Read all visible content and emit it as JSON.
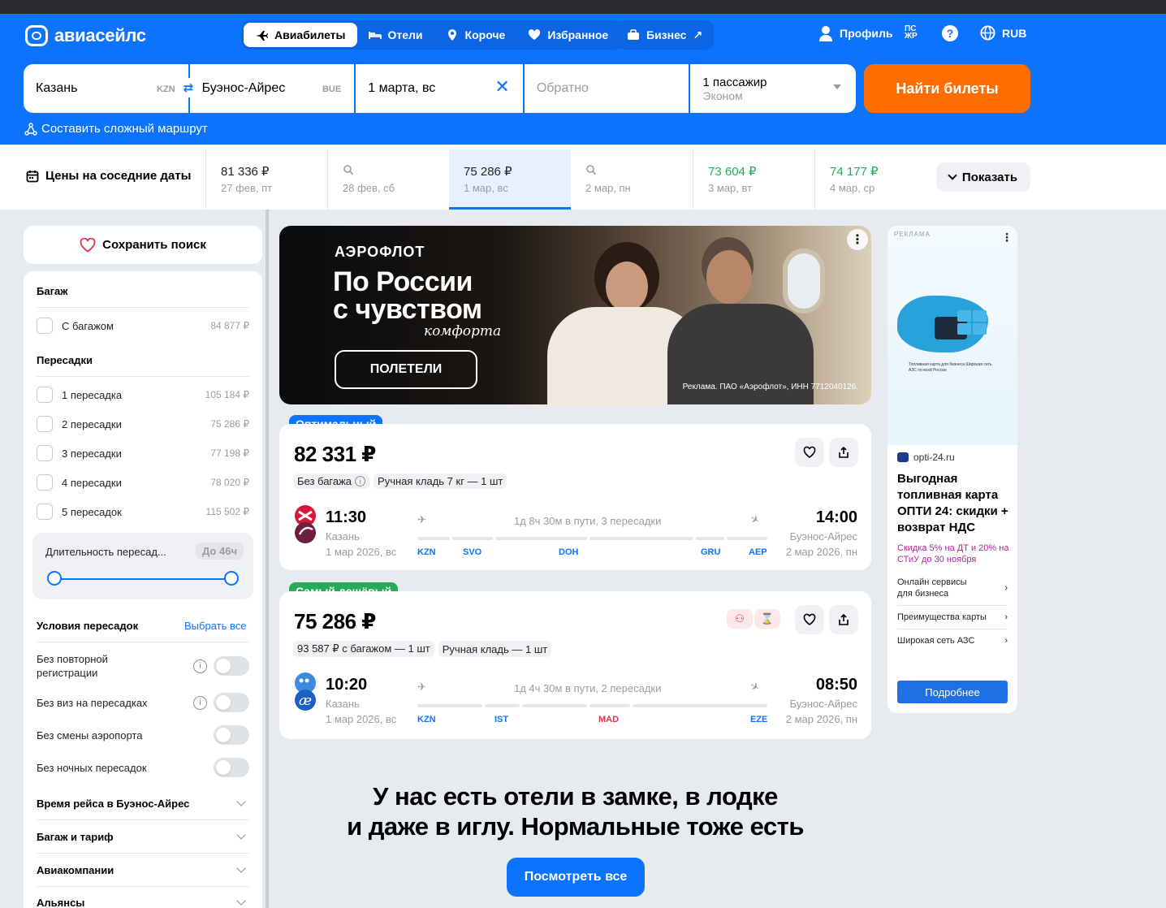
{
  "header": {
    "logo": "авиасейлс",
    "tabs": [
      {
        "label": "Авиабилеты",
        "icon": "plane-icon",
        "active": true
      },
      {
        "label": "Отели",
        "icon": "bed-icon"
      },
      {
        "label": "Короче",
        "icon": "pin-icon"
      },
      {
        "label": "Избранное",
        "icon": "heart-icon"
      }
    ],
    "business": "Бизнес",
    "profile": "Профиль",
    "pswd": "ПС ЖР",
    "currency": "RUB"
  },
  "search": {
    "from_city": "Казань",
    "from_code": "KZN",
    "to_city": "Буэнос-Айрес",
    "to_code": "BUE",
    "depart_date": "1 марта, вс",
    "return_placeholder": "Обратно",
    "passengers": "1 пассажир",
    "cabin": "Эконом",
    "find_button": "Найти билеты",
    "complex_route": "Составить сложный маршрут"
  },
  "dates": {
    "title": "Цены на соседние даты",
    "items": [
      {
        "price": "81 336 ₽",
        "date": "27 фев, пт"
      },
      {
        "price": "",
        "date": "28 фев, сб"
      },
      {
        "price": "75 286 ₽",
        "date": "1 мар, вс",
        "selected": true
      },
      {
        "price": "",
        "date": "2 мар, пн"
      },
      {
        "price": "73 604 ₽",
        "date": "3 мар, вт",
        "cheap": true
      },
      {
        "price": "74 177 ₽",
        "date": "4 мар, ср",
        "cheap": true
      }
    ],
    "show_button": "Показать"
  },
  "sidebar": {
    "save_search": "Сохранить поиск",
    "baggage_title": "Багаж",
    "baggage_items": [
      {
        "label": "С багажом",
        "price": "84 877 ₽"
      }
    ],
    "stops_title": "Пересадки",
    "stops_items": [
      {
        "label": "1 пересадка",
        "price": "105 184 ₽"
      },
      {
        "label": "2 пересадки",
        "price": "75 286 ₽"
      },
      {
        "label": "3 пересадки",
        "price": "77 198 ₽"
      },
      {
        "label": "4 пересадки",
        "price": "78 020 ₽"
      },
      {
        "label": "5 пересадок",
        "price": "115 502 ₽"
      }
    ],
    "duration_label": "Длительность пересад...",
    "duration_badge": "До 46ч",
    "conditions_title": "Условия пересадок",
    "select_all": "Выбрать все",
    "conditions": [
      {
        "label": "Без повторной регистрации",
        "info": true
      },
      {
        "label": "Без виз на пересадках",
        "info": true
      },
      {
        "label": "Без смены аэропорта",
        "info": false
      },
      {
        "label": "Без ночных пересадок",
        "info": false
      }
    ],
    "accordions": [
      "Время рейса в Буэнос-Айрес",
      "Багаж и тариф",
      "Авиакомпании",
      "Альянсы"
    ]
  },
  "banner": {
    "brand": "АЭРОФЛОТ",
    "headline_1": "По России",
    "headline_2": "с чувством",
    "script": "комфорта",
    "cta": "ПОЛЕТЕЛИ",
    "legal": "Реклама. ПАО «Аэрофлот», ИНН 7712040126."
  },
  "tickets": [
    {
      "tag": "Оптимальный",
      "tag_color": "#0c73fe",
      "price": "82 331 ₽",
      "chips": [
        "Без багажа",
        "Ручная кладь 7 кг — 1 шт"
      ],
      "dep_time": "11:30",
      "dep_city": "Казань",
      "dep_date": "1 мар 2026, вс",
      "duration": "1д 8ч 30м в пути, 3 пересадки",
      "arr_time": "14:00",
      "arr_city": "Буэнос-Айрес",
      "arr_date": "2 мар 2026, пн",
      "airports": [
        "KZN",
        "SVO",
        "DOH",
        "GRU",
        "AEP"
      ]
    },
    {
      "tag": "Самый дешёвый",
      "tag_color": "#25ab58",
      "price": "75 286 ₽",
      "chips": [
        "93 587 ₽ с багажом — 1 шт",
        "Ручная кладь — 1 шт"
      ],
      "dep_time": "10:20",
      "dep_city": "Казань",
      "dep_date": "1 мар 2026, вс",
      "duration": "1д 4ч 30м в пути, 2 пересадки",
      "arr_time": "08:50",
      "arr_city": "Буэнос-Айрес",
      "arr_date": "2 мар 2026, пн",
      "airports": [
        "KZN",
        "IST",
        "MAD",
        "EZE"
      ]
    }
  ],
  "ad": {
    "label": "РЕКЛАМА",
    "mini_text": "Топливная карта для бизнеса Широкая сеть АЗС по всей России",
    "source": "opti-24.ru",
    "title": "Выгодная топливная карта ОПТИ 24: скидки + возврат НДС",
    "promo": "Скидка 5% на ДТ и 20% на СТиУ до 30 ноября",
    "links": [
      "Онлайн сервисы для бизнеса",
      "Преимущества карты",
      "Широкая сеть АЗС"
    ],
    "button": "Подробнее"
  },
  "promo": {
    "line1": "У нас есть отели в замке, в лодке",
    "line2": "и даже в иглу. Нормальные тоже есть",
    "button": "Посмотреть все"
  }
}
